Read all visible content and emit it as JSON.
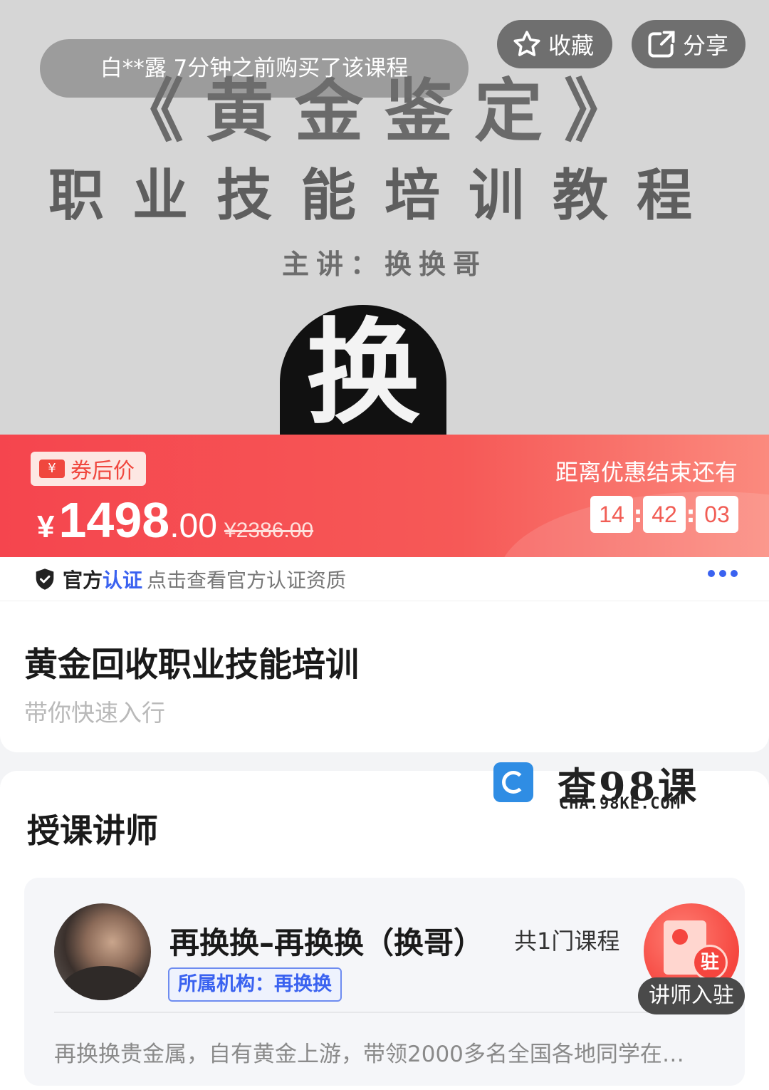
{
  "hero": {
    "title_line1": "《黄金鉴定》",
    "title_line2": "职业技能培训教程",
    "presenter_line": "主讲：换换哥",
    "seal_char": "换",
    "toast": "白**露 7分钟之前购买了该课程",
    "favorite_label": "收藏",
    "share_label": "分享",
    "icons": {
      "favorite": "star-icon",
      "share": "share-icon"
    }
  },
  "price": {
    "coupon_label": "券后价",
    "coupon_icon_text": "¥",
    "currency": "¥",
    "amount_int": "1498",
    "amount_dec": ".00",
    "original": "¥2386.00",
    "countdown_label": "距离优惠结束还有",
    "countdown": {
      "hours": "14",
      "minutes": "42",
      "seconds": "03"
    },
    "colors": {
      "banner": "#f5454e",
      "accent": "#f0473e"
    }
  },
  "cert": {
    "label_part1": "官方",
    "label_part2": "认证",
    "description": "点击查看官方认证资质",
    "icons": {
      "shield": "shield-icon",
      "more": "more-dots-icon"
    },
    "accent": "#3a62f0"
  },
  "course": {
    "title": "黄金回收职业技能培训",
    "subtitle": "带你快速入行"
  },
  "teachers": {
    "section_title": "授课讲师",
    "watermark_cn": "查98课",
    "watermark_en": "CHA.98KE.COM",
    "teacher": {
      "name": "再换换–再换换（换哥）",
      "course_count": "共1门课程",
      "org": "所属机构：再换换",
      "description": "再换换贵金属，自有黄金上游，带领2000多名全国各地同学在…"
    },
    "join": {
      "badge": "驻",
      "label": "讲师入驻"
    }
  }
}
